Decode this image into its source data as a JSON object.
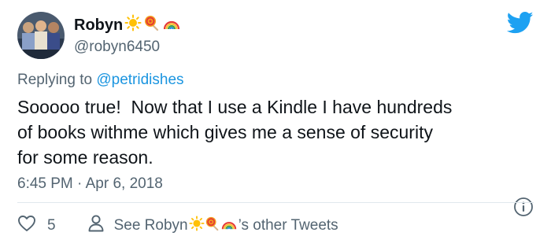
{
  "user": {
    "display_name": "Robyn",
    "handle": "@robyn6450",
    "name_emojis": [
      "sun-emoji",
      "lollipop-emoji",
      "rainbow-emoji"
    ]
  },
  "reply": {
    "prefix": "Replying to",
    "mention": "@petridishes"
  },
  "tweet": {
    "text": "Sooooo true!  Now that I use a Kindle I have hundreds\nof books withme which gives me a sense of security\nfor some reason.",
    "timestamp": "6:45 PM · Apr 6, 2018"
  },
  "footer": {
    "like_count": "5",
    "see_prefix": "See Robyn",
    "see_suffix": "’s other Tweets"
  },
  "colors": {
    "brand": "#1da1f2",
    "link": "#1b95e0",
    "secondary_text": "#536471",
    "divider": "#e1e8ed"
  },
  "icons": [
    "twitter-bird-icon",
    "info-icon",
    "heart-icon",
    "person-icon"
  ]
}
